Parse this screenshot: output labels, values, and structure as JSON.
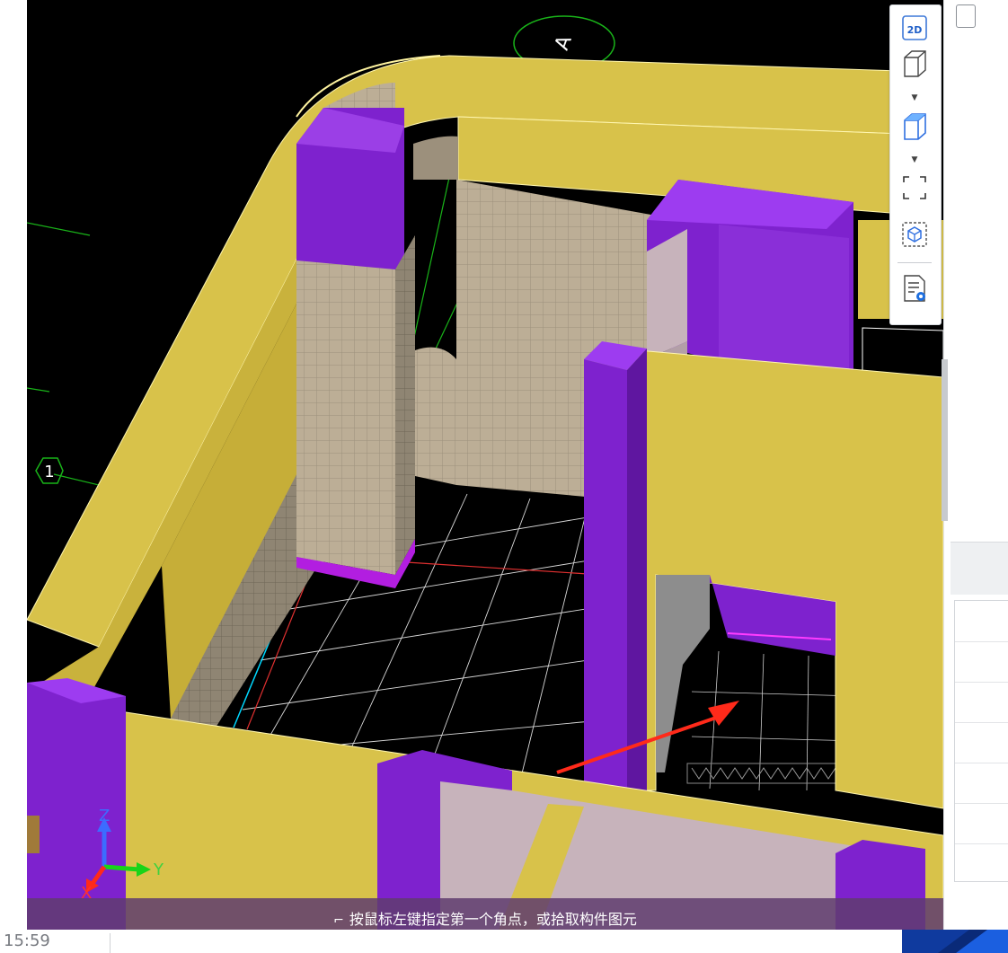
{
  "status": {
    "message": "按鼠标左键指定第一个角点，或拾取构件图元"
  },
  "taskbar": {
    "clock": "15:59"
  },
  "toolbar": {
    "view_2d_label": "2D"
  },
  "viewport": {
    "axis_labels": {
      "z": "Z",
      "y": "Y",
      "x": "X"
    },
    "grid_markers": [
      {
        "label": "A"
      },
      {
        "label": "1"
      }
    ]
  },
  "colors": {
    "wall": "#d8c24a",
    "column": "#7e22ce",
    "tile": "#b9ab95",
    "floor_grid": "#ffffff",
    "axis_line": "#19b419",
    "arrow": "#ff2a1a",
    "background": "#000000"
  },
  "icons": [
    "2d-view-icon",
    "3d-box-icon",
    "3d-box-selected-icon",
    "region-select-icon",
    "component-view-icon",
    "display-settings-icon"
  ]
}
